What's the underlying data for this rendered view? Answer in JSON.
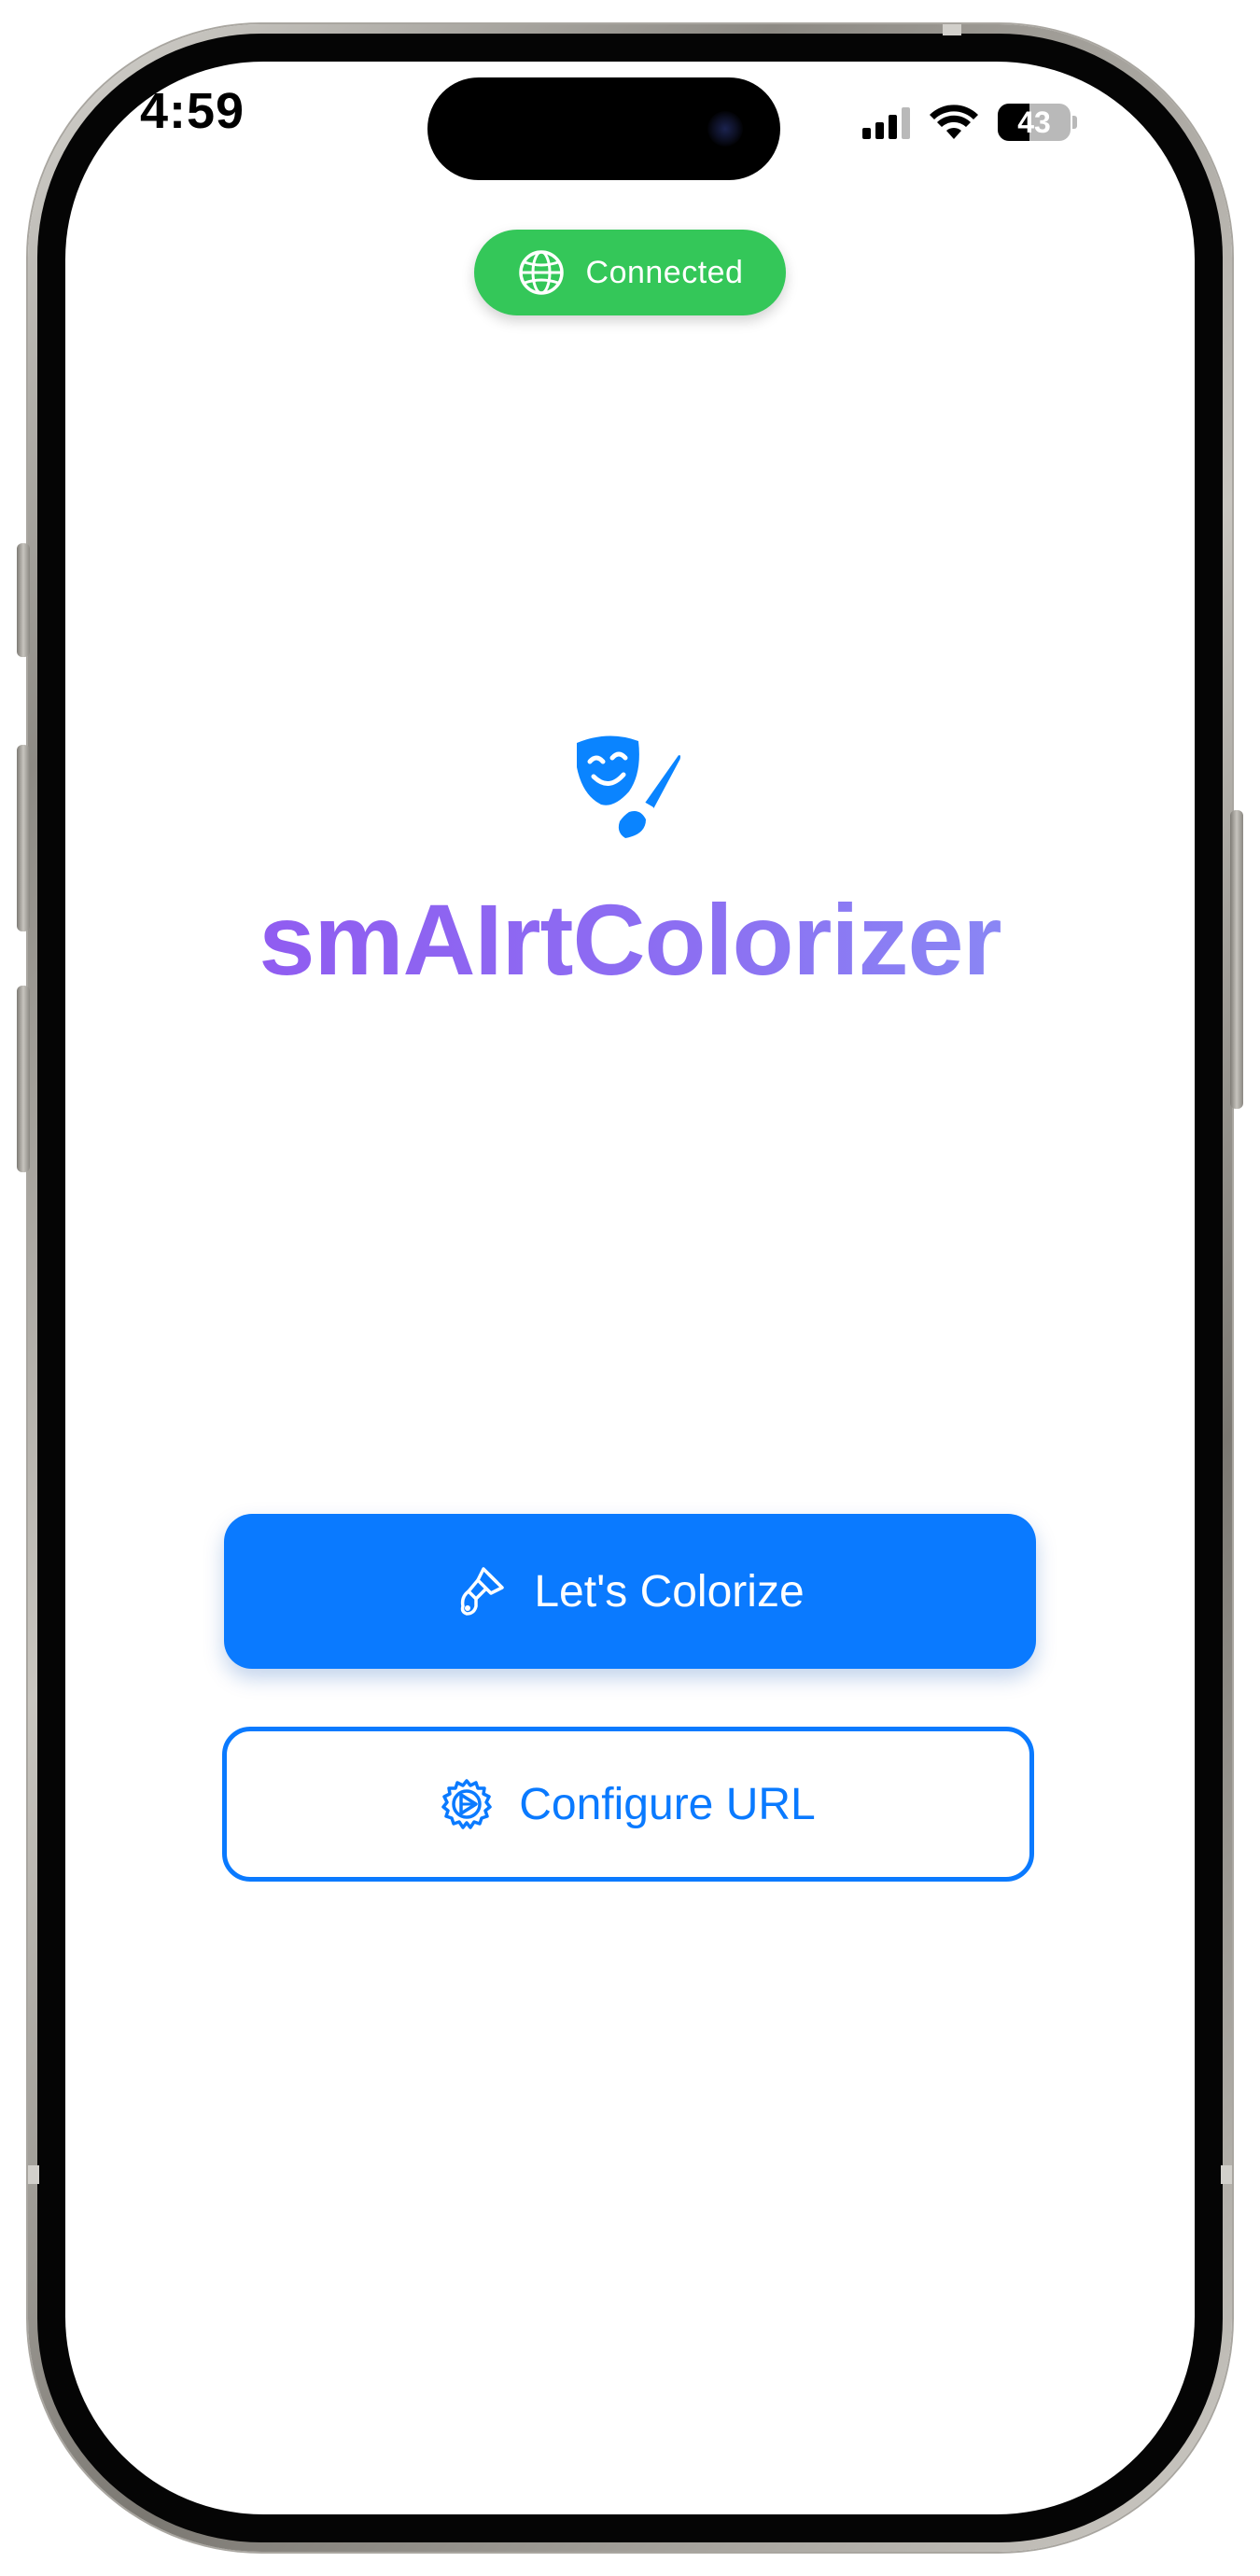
{
  "status_bar": {
    "time": "4:59",
    "signal_icon": "cellular-signal-icon",
    "wifi_icon": "wifi-icon",
    "battery_level": "43",
    "battery_fraction": 0.43
  },
  "connection_pill": {
    "label": "Connected",
    "icon": "globe-icon",
    "color": "#34c759"
  },
  "app": {
    "icon": "theater-mask-paintbrush-icon",
    "title": "smAIrtColorizer",
    "title_gradient": [
      "#9251f0",
      "#889af7"
    ],
    "icon_color": "#0a84ff"
  },
  "actions": {
    "primary": {
      "label": "Let's Colorize",
      "icon": "paintbrush-icon",
      "color": "#0a7aff"
    },
    "secondary": {
      "label": "Configure URL",
      "icon": "gear-icon",
      "color": "#0a7aff"
    }
  }
}
